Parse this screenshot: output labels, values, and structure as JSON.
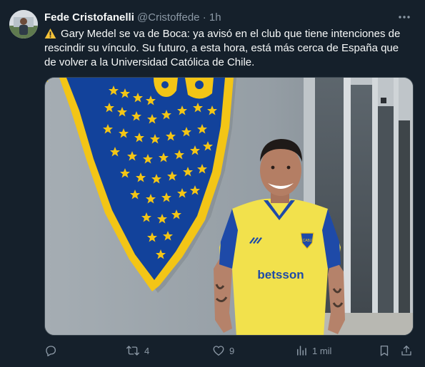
{
  "author": {
    "name": "Fede Cristofanelli",
    "handle": "@Cristoffede",
    "separator": "·",
    "time": "1h"
  },
  "tweet": {
    "warning_icon": "warning-icon",
    "text": "Gary Medel se va de Boca: ya avisó en el club que tiene intenciones de rescindir su vínculo. Su futuro, a esta hora, está más cerca de España que de volver a la Universidad Católica de Chile."
  },
  "media": {
    "shirt_sponsor": "betsson",
    "shield_text": "CABJ"
  },
  "actions": {
    "replies": "",
    "retweets": "4",
    "likes": "9",
    "views": "1 mil"
  },
  "colors": {
    "background": "#15202b",
    "text": "#f7f9f9",
    "secondary": "#8b98a5",
    "boca_blue": "#12429b",
    "boca_gold": "#f3c516"
  }
}
